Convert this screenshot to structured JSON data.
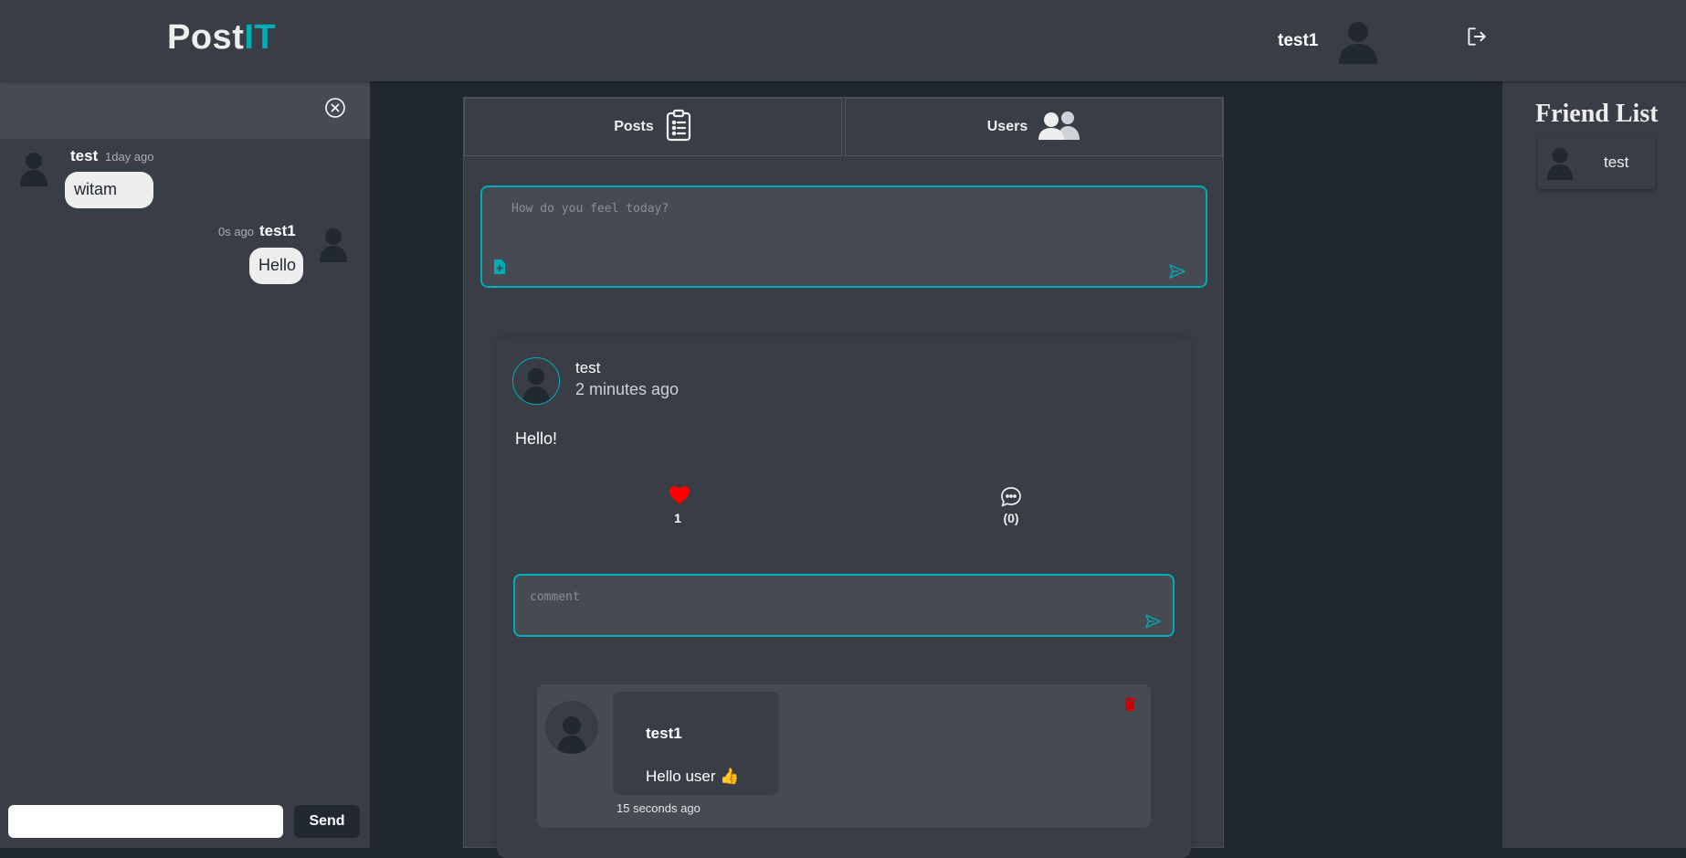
{
  "header": {
    "logo_part1": "Post",
    "logo_part2": "IT",
    "username": "test1"
  },
  "chat": {
    "messages": [
      {
        "author": "test",
        "time": "1day ago",
        "text": "witam"
      },
      {
        "author": "test1",
        "time": "0s ago",
        "text": "Hello"
      }
    ],
    "input_value": "",
    "send_label": "Send"
  },
  "tabs": [
    {
      "label": "Posts"
    },
    {
      "label": "Users"
    }
  ],
  "composer": {
    "placeholder": "How do you feel today?"
  },
  "post": {
    "author": "test",
    "time": "2 minutes ago",
    "body": "Hello!",
    "likes": "1",
    "comments_count": "(0)",
    "comment_placeholder": "comment",
    "comments": [
      {
        "author": "test1",
        "text": "Hello user 👍",
        "time": "15 seconds ago"
      }
    ]
  },
  "friends": {
    "title": "Friend List",
    "items": [
      {
        "name": "test"
      }
    ]
  },
  "colors": {
    "accent": "#00adb5",
    "background": "#222831",
    "panel": "#393e46",
    "like": "#ff0000",
    "delete": "#cc0000"
  }
}
